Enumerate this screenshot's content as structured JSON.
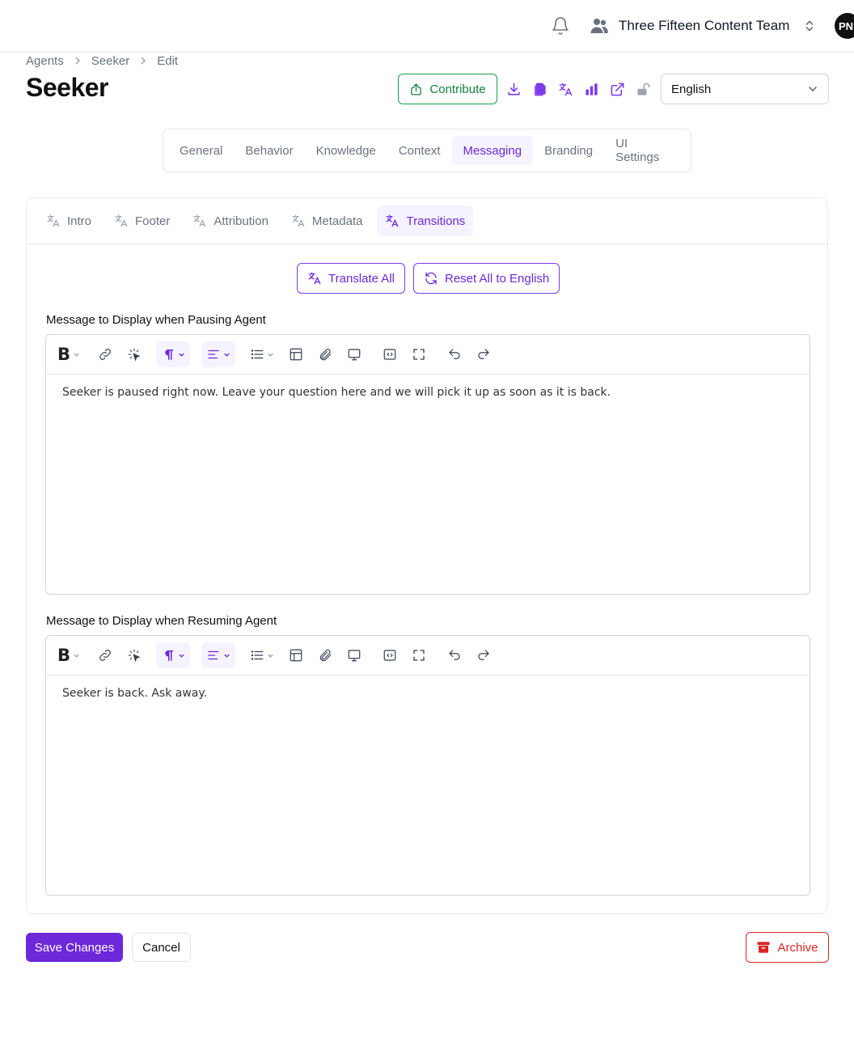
{
  "header": {
    "team_name": "Three Fifteen Content Team",
    "avatar_initials": "PN"
  },
  "breadcrumb": [
    "Agents",
    "Seeker",
    "Edit"
  ],
  "page": {
    "title": "Seeker",
    "contribute_label": "Contribute",
    "action_icons": [
      "download-icon",
      "copy-icon",
      "translate-icon",
      "chart-bar-icon",
      "external-link-icon",
      "unlock-icon"
    ],
    "language": "English"
  },
  "main_tabs": [
    "General",
    "Behavior",
    "Knowledge",
    "Context",
    "Messaging",
    "Branding",
    "UI Settings"
  ],
  "main_tab_active": "Messaging",
  "sub_tabs": [
    "Intro",
    "Footer",
    "Attribution",
    "Metadata",
    "Transitions"
  ],
  "sub_tab_active": "Transitions",
  "translate_all_label": "Translate All",
  "reset_all_label": "Reset All to English",
  "fields": {
    "pausing": {
      "label": "Message to Display when Pausing Agent",
      "content": "Seeker is paused right now. Leave your question here and we will pick it up as soon as it is back."
    },
    "resuming": {
      "label": "Message to Display when Resuming Agent",
      "content": "Seeker is back. Ask away."
    }
  },
  "footer": {
    "save_label": "Save Changes",
    "cancel_label": "Cancel",
    "archive_label": "Archive"
  },
  "colors": {
    "accent": "#6d28d9",
    "contribute_green": "#15803d",
    "archive_red": "#dc2626"
  }
}
